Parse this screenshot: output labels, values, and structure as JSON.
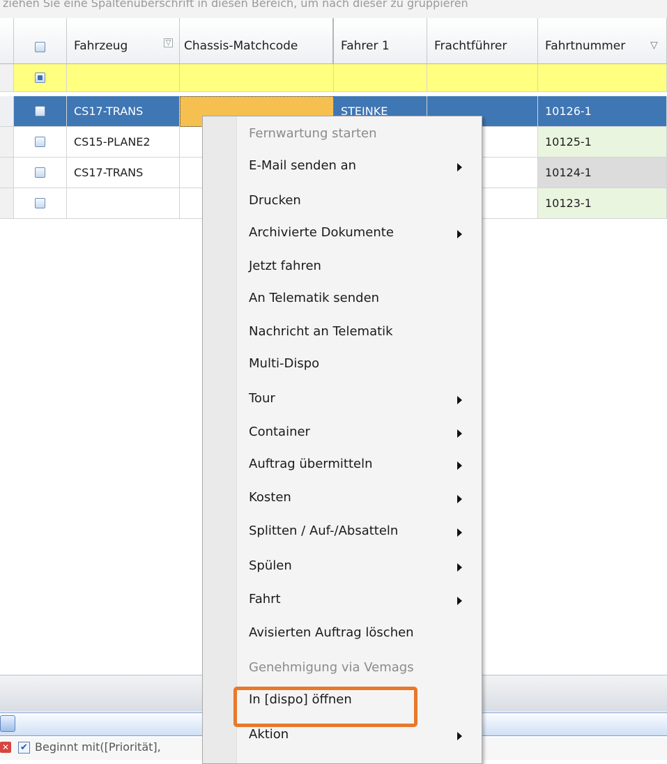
{
  "group_hint": "ziehen Sie eine Spaltenüberschrift in diesen Bereich, um nach dieser zu gruppieren",
  "columns": [
    "Fahrzeug",
    "Chassis-Matchcode",
    "Fahrer 1",
    "Frachtführer",
    "Fahrtnummer"
  ],
  "rows": [
    {
      "fahrzeug": "CS17-TRANS",
      "fahrer": "STEINKE",
      "fahrtnummer": "10126-1"
    },
    {
      "fahrzeug": "CS15-PLANE2",
      "fahrer": "",
      "fahrtnummer": "10125-1"
    },
    {
      "fahrzeug": "CS17-TRANS",
      "fahrer": "",
      "fahrtnummer": "10124-1"
    },
    {
      "fahrzeug": "",
      "fahrer": "",
      "fahrtnummer": "10123-1"
    }
  ],
  "context_menu": {
    "items": [
      {
        "label": "Fernwartung starten",
        "disabled": true,
        "submenu": false
      },
      {
        "label": "E-Mail senden an",
        "disabled": false,
        "submenu": true
      },
      {
        "label": "Drucken",
        "disabled": false,
        "submenu": false
      },
      {
        "label": "Archivierte Dokumente",
        "disabled": false,
        "submenu": true
      },
      {
        "label": "Jetzt fahren",
        "disabled": false,
        "submenu": false
      },
      {
        "label": "An Telematik senden",
        "disabled": false,
        "submenu": false
      },
      {
        "label": "Nachricht an Telematik",
        "disabled": false,
        "submenu": false
      },
      {
        "label": "Multi-Dispo",
        "disabled": false,
        "submenu": false
      },
      {
        "label": "Tour",
        "disabled": false,
        "submenu": true
      },
      {
        "label": "Container",
        "disabled": false,
        "submenu": true
      },
      {
        "label": "Auftrag übermitteln",
        "disabled": false,
        "submenu": true
      },
      {
        "label": "Kosten",
        "disabled": false,
        "submenu": true
      },
      {
        "label": "Splitten / Auf-/Absatteln",
        "disabled": false,
        "submenu": true
      },
      {
        "label": "Spülen",
        "disabled": false,
        "submenu": true
      },
      {
        "label": "Fahrt",
        "disabled": false,
        "submenu": true
      },
      {
        "label": "Avisierten Auftrag löschen",
        "disabled": false,
        "submenu": false
      },
      {
        "label": "Genehmigung via Vemags",
        "disabled": true,
        "submenu": false
      },
      {
        "label": "In [dispo] öffnen",
        "disabled": false,
        "submenu": false
      },
      {
        "label": "Aktion",
        "disabled": false,
        "submenu": true
      }
    ]
  },
  "status_filter": "Beginnt mit([Priorität],",
  "colors": {
    "selection": "#3f76b4",
    "filter_row": "#ffff80",
    "highlight": "#e8782a",
    "chassis_cell_selected": "#f5c04f",
    "fahrtnummer_green": "#eaf5df"
  }
}
